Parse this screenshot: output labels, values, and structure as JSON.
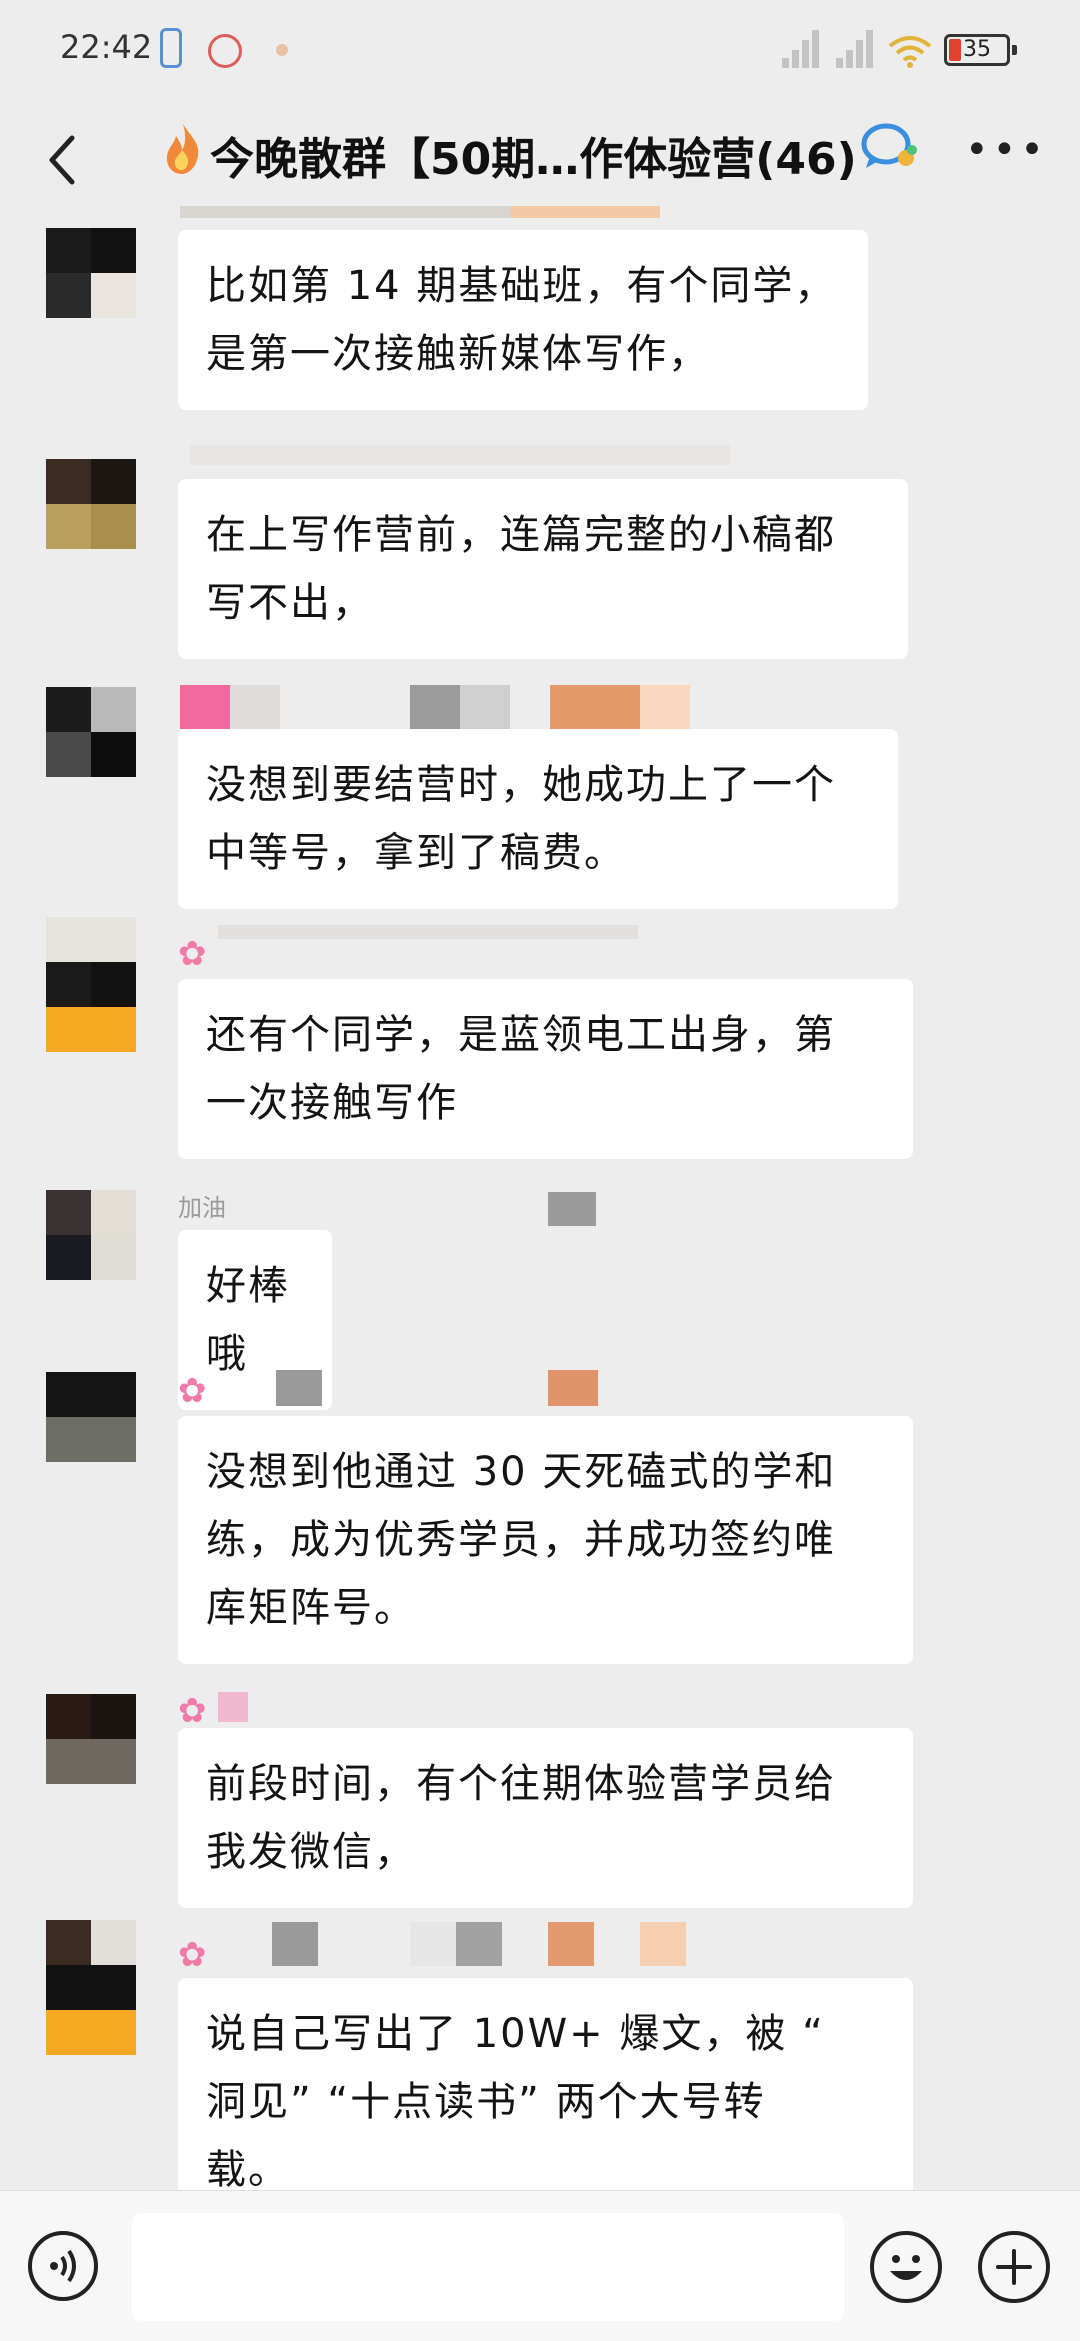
{
  "status_bar": {
    "time": "22:42",
    "battery": "35"
  },
  "header": {
    "title": "今晚散群【50期…作体验营(46)"
  },
  "messages": [
    {
      "lines": [
        "比如第 14 期基础班，有个同学，",
        "是第一次接触新媒体写作，"
      ]
    },
    {
      "lines": [
        "在上写作营前，连篇完整的小稿都",
        "写不出，"
      ]
    },
    {
      "lines": [
        "没想到要结营时，她成功上了一个",
        "中等号，拿到了稿费。"
      ]
    },
    {
      "lines": [
        "还有个同学，是蓝领电工出身，第",
        "一次接触写作"
      ]
    },
    {
      "sender_label": "加油",
      "lines": [
        "好棒哦"
      ]
    },
    {
      "lines": [
        "没想到他通过 30 天死磕式的学和",
        "练，成为优秀学员，并成功签约唯",
        "库矩阵号。"
      ]
    },
    {
      "lines": [
        "前段时间，有个往期体验营学员给",
        "我发微信，"
      ]
    },
    {
      "lines": [
        "说自己写出了 10W+ 爆文，被 “",
        "洞见” “十点读书” 两个大号转",
        "载。"
      ]
    }
  ],
  "colors": {
    "background": "#ededed",
    "bubble": "#ffffff",
    "bottom_bar": "#f7f7f7"
  },
  "icons": [
    "back-arrow-icon",
    "flame-icon",
    "chat-badge-icon",
    "more-icon",
    "voice-icon",
    "emoji-icon",
    "plus-icon",
    "flower-icon"
  ]
}
